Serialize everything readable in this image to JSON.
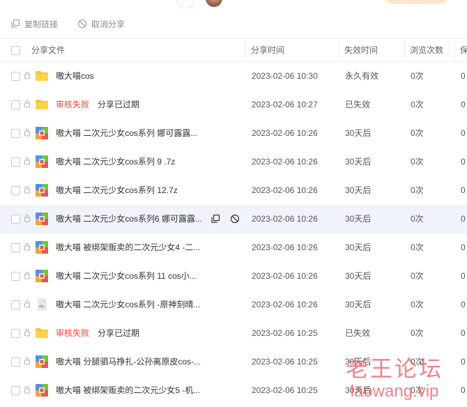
{
  "toolbar": {
    "copy_label": "复制链接",
    "cancel_label": "取消分享"
  },
  "table": {
    "headers": {
      "name": "分享文件",
      "time": "分享时间",
      "expire": "失效时间",
      "views": "浏览次数",
      "save": "保"
    },
    "rows": [
      {
        "icon": "folder-icon",
        "fail": "",
        "name": "嗷大喵cos",
        "time": "2023-02-06 10:30",
        "expire": "永久有效",
        "views": "0次",
        "save": "0"
      },
      {
        "icon": "folder-icon",
        "fail": "审核失败",
        "name": "分享已过期",
        "time": "2023-02-06 10:27",
        "expire": "已失效",
        "views": "0次",
        "save": "0"
      },
      {
        "icon": "archive-icon",
        "fail": "",
        "name": "嗷大喵 二次元少女cos系列 娜可露露...",
        "time": "2023-02-06 10:26",
        "expire": "30天后",
        "views": "0次",
        "save": "0"
      },
      {
        "icon": "archive-icon",
        "fail": "",
        "name": "嗷大喵 二次元少女cos系列 9 .7z",
        "time": "2023-02-06 10:26",
        "expire": "30天后",
        "views": "0次",
        "save": "0"
      },
      {
        "icon": "archive-icon",
        "fail": "",
        "name": "嗷大喵 二次元少女cos系列 12.7z",
        "time": "2023-02-06 10:26",
        "expire": "30天后",
        "views": "0次",
        "save": "0"
      },
      {
        "icon": "archive-icon",
        "fail": "",
        "name": "嗷大喵 二次元少女cos系列6 娜可露露...",
        "time": "2023-02-06 10:26",
        "expire": "30天后",
        "views": "0次",
        "save": "0"
      },
      {
        "icon": "archive-icon",
        "fail": "",
        "name": "嗷大喵 被绑架贩卖的二次元少女4 -二...",
        "time": "2023-02-06 10:26",
        "expire": "30天后",
        "views": "0次",
        "save": "0"
      },
      {
        "icon": "archive-icon",
        "fail": "",
        "name": "嗷大喵 二次元少女cos系列 11 cos小...",
        "time": "2023-02-06 10:26",
        "expire": "30天后",
        "views": "0次",
        "save": "0"
      },
      {
        "icon": "cloud-file-icon",
        "fail": "",
        "name": "嗷大喵 二次元少女cos系列 -原神刻晴...",
        "time": "2023-02-06 10:26",
        "expire": "30天后",
        "views": "0次",
        "save": "0"
      },
      {
        "icon": "folder-icon",
        "fail": "审核失败",
        "name": "分享已过期",
        "time": "2023-02-06 10:25",
        "expire": "已失效",
        "views": "0次",
        "save": "0"
      },
      {
        "icon": "archive-icon",
        "fail": "",
        "name": "嗷大喵 分腿驷马挣扎-公孙离原皮cos-...",
        "time": "2023-02-06 10:25",
        "expire": "30天后",
        "views": "0次",
        "save": "0"
      },
      {
        "icon": "archive-icon",
        "fail": "",
        "name": "嗷大喵 被绑架贩卖的二次元少女5 -机...",
        "time": "2023-02-06 10:25",
        "expire": "30天后",
        "views": "0次",
        "save": "0"
      }
    ]
  },
  "watermark": {
    "cn": "老王论坛",
    "en": "laowang.vip"
  },
  "colors": {
    "fail": "#e34a3a",
    "row_highlight": "#f1f3fb",
    "watermark": "#e8505a"
  }
}
